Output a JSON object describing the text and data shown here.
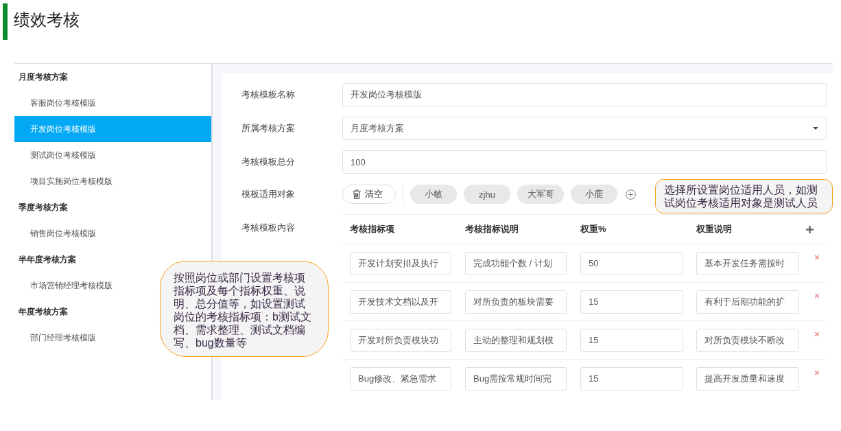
{
  "page_title": "绩效考核",
  "sidebar": {
    "groups": [
      {
        "label": "月度考核方案",
        "children": [
          {
            "label": "客服岗位考核模版",
            "selected": false
          },
          {
            "label": "开发岗位考核模版",
            "selected": true
          },
          {
            "label": "测试岗位考核模版",
            "selected": false
          },
          {
            "label": "项目实施岗位考核模版",
            "selected": false
          }
        ]
      },
      {
        "label": "季度考核方案",
        "children": [
          {
            "label": "销售岗位考核模版",
            "selected": false
          }
        ]
      },
      {
        "label": "半年度考核方案",
        "children": [
          {
            "label": "市场营销经理考核模版",
            "selected": false
          }
        ]
      },
      {
        "label": "年度考核方案",
        "children": [
          {
            "label": "部门经理考核模版",
            "selected": false
          }
        ]
      }
    ]
  },
  "form": {
    "fields": [
      {
        "label": "考核模板名称",
        "kind": "text",
        "value": "开发岗位考核模版"
      },
      {
        "label": "所属考核方案",
        "kind": "select",
        "value": "月度考核方案"
      },
      {
        "label": "考核模板总分",
        "kind": "text",
        "value": "100"
      }
    ],
    "applicable": {
      "label": "模板适用对象",
      "clear_button": "清空",
      "tags": [
        "小敏",
        "zjhu",
        "大军哥",
        "小鹿"
      ]
    },
    "content": {
      "label": "考核模板内容",
      "columns": [
        "考核指标项",
        "考核指标说明",
        "权重%",
        "权重说明"
      ],
      "rows": [
        [
          "开发计划安排及执行",
          "完成功能个数 / 计划",
          "50",
          "基本开发任务需按时"
        ],
        [
          "开发技术文档以及开",
          "对所负责的板块需要",
          "15",
          "有利于后期功能的扩"
        ],
        [
          "开发对所负责模块功",
          "主动的整理和规划模",
          "15",
          "对所负责模块不断改"
        ],
        [
          "Bug修改、紧急需求",
          "Bug需按常规时间完",
          "15",
          "提高开发质量和速度"
        ]
      ]
    }
  },
  "callouts": [
    "选择所设置岗位适用人员，如测试岗位考核适用对象是测试人员",
    "按照岗位或部门设置考核项指标项及每个指标权重、说明、总分值等，如设置测试岗位的考核指标项：b测试文档、需求整理、测试文档编写、bug数量等"
  ]
}
